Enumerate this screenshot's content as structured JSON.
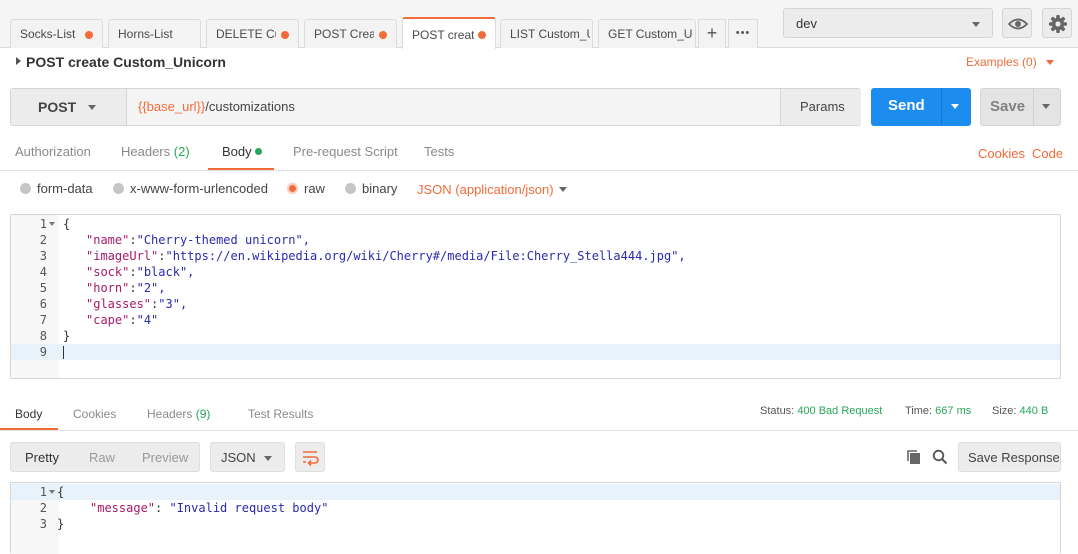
{
  "tabs": [
    {
      "label": "Socks-List",
      "unsaved": true
    },
    {
      "label": "Horns-List",
      "unsaved": false
    },
    {
      "label": "DELETE Cu",
      "unsaved": true
    },
    {
      "label": "POST Creat",
      "unsaved": true
    },
    {
      "label": "POST creat",
      "unsaved": true,
      "active": true
    },
    {
      "label": "LIST Custom_Uni",
      "unsaved": false
    },
    {
      "label": "GET Custom_Uni",
      "unsaved": false
    }
  ],
  "tab_actions": {
    "add": "+",
    "more": "•••"
  },
  "environment": {
    "selected": "dev"
  },
  "request": {
    "name": "POST create Custom_Unicorn",
    "examples": "Examples (0)",
    "method": "POST",
    "url_variable": "{{base_url}}",
    "url_path": "/customizations",
    "params_label": "Params",
    "send_label": "Send",
    "save_label": "Save"
  },
  "request_tabs": [
    {
      "label": "Authorization"
    },
    {
      "label": "Headers",
      "count": "(2)"
    },
    {
      "label": "Body",
      "active": true,
      "indicator": "green-dot"
    },
    {
      "label": "Pre-request Script"
    },
    {
      "label": "Tests"
    }
  ],
  "request_links": {
    "cookies": "Cookies",
    "code": "Code"
  },
  "body_types": [
    {
      "label": "form-data",
      "selected": false
    },
    {
      "label": "x-www-form-urlencoded",
      "selected": false
    },
    {
      "label": "raw",
      "selected": true
    },
    {
      "label": "binary",
      "selected": false
    }
  ],
  "content_type": "JSON (application/json)",
  "request_body": {
    "line_numbers": [
      "1",
      "2",
      "3",
      "4",
      "5",
      "6",
      "7",
      "8",
      "9"
    ],
    "open_brace": "{",
    "close_brace": "}",
    "fields": [
      {
        "key": "\"name\"",
        "value": "\"Cherry-themed unicorn\","
      },
      {
        "key": "\"imageUrl\"",
        "value": "\"https://en.wikipedia.org/wiki/Cherry#/media/File:Cherry_Stella444.jpg\","
      },
      {
        "key": "\"sock\"",
        "value": "\"black\","
      },
      {
        "key": "\"horn\"",
        "value": "\"2\","
      },
      {
        "key": "\"glasses\"",
        "value": "\"3\","
      },
      {
        "key": "\"cape\"",
        "value": "\"4\""
      }
    ]
  },
  "response_tabs": [
    {
      "label": "Body",
      "active": true
    },
    {
      "label": "Cookies"
    },
    {
      "label": "Headers",
      "count": "(9)"
    },
    {
      "label": "Test Results"
    }
  ],
  "response_status": {
    "status_label": "Status:",
    "status_value": "400 Bad Request",
    "time_label": "Time:",
    "time_value": "667 ms",
    "size_label": "Size:",
    "size_value": "440 B"
  },
  "response_view": {
    "modes": [
      "Pretty",
      "Raw",
      "Preview"
    ],
    "selected_mode": "Pretty",
    "format": "JSON",
    "save_response": "Save Response"
  },
  "response_body": {
    "line_numbers": [
      "1",
      "2",
      "3"
    ],
    "open_brace": "{",
    "key": "\"message\"",
    "value": "\"Invalid request body\"",
    "close_brace": "}"
  },
  "colors": {
    "accent": "#f26b3a",
    "primary": "#1c8cef",
    "success": "#26a65b"
  },
  "icons": [
    "eye-icon",
    "gear-icon",
    "plus-icon",
    "more-icon",
    "wrap-lines-icon",
    "copy-icon",
    "search-icon"
  ]
}
